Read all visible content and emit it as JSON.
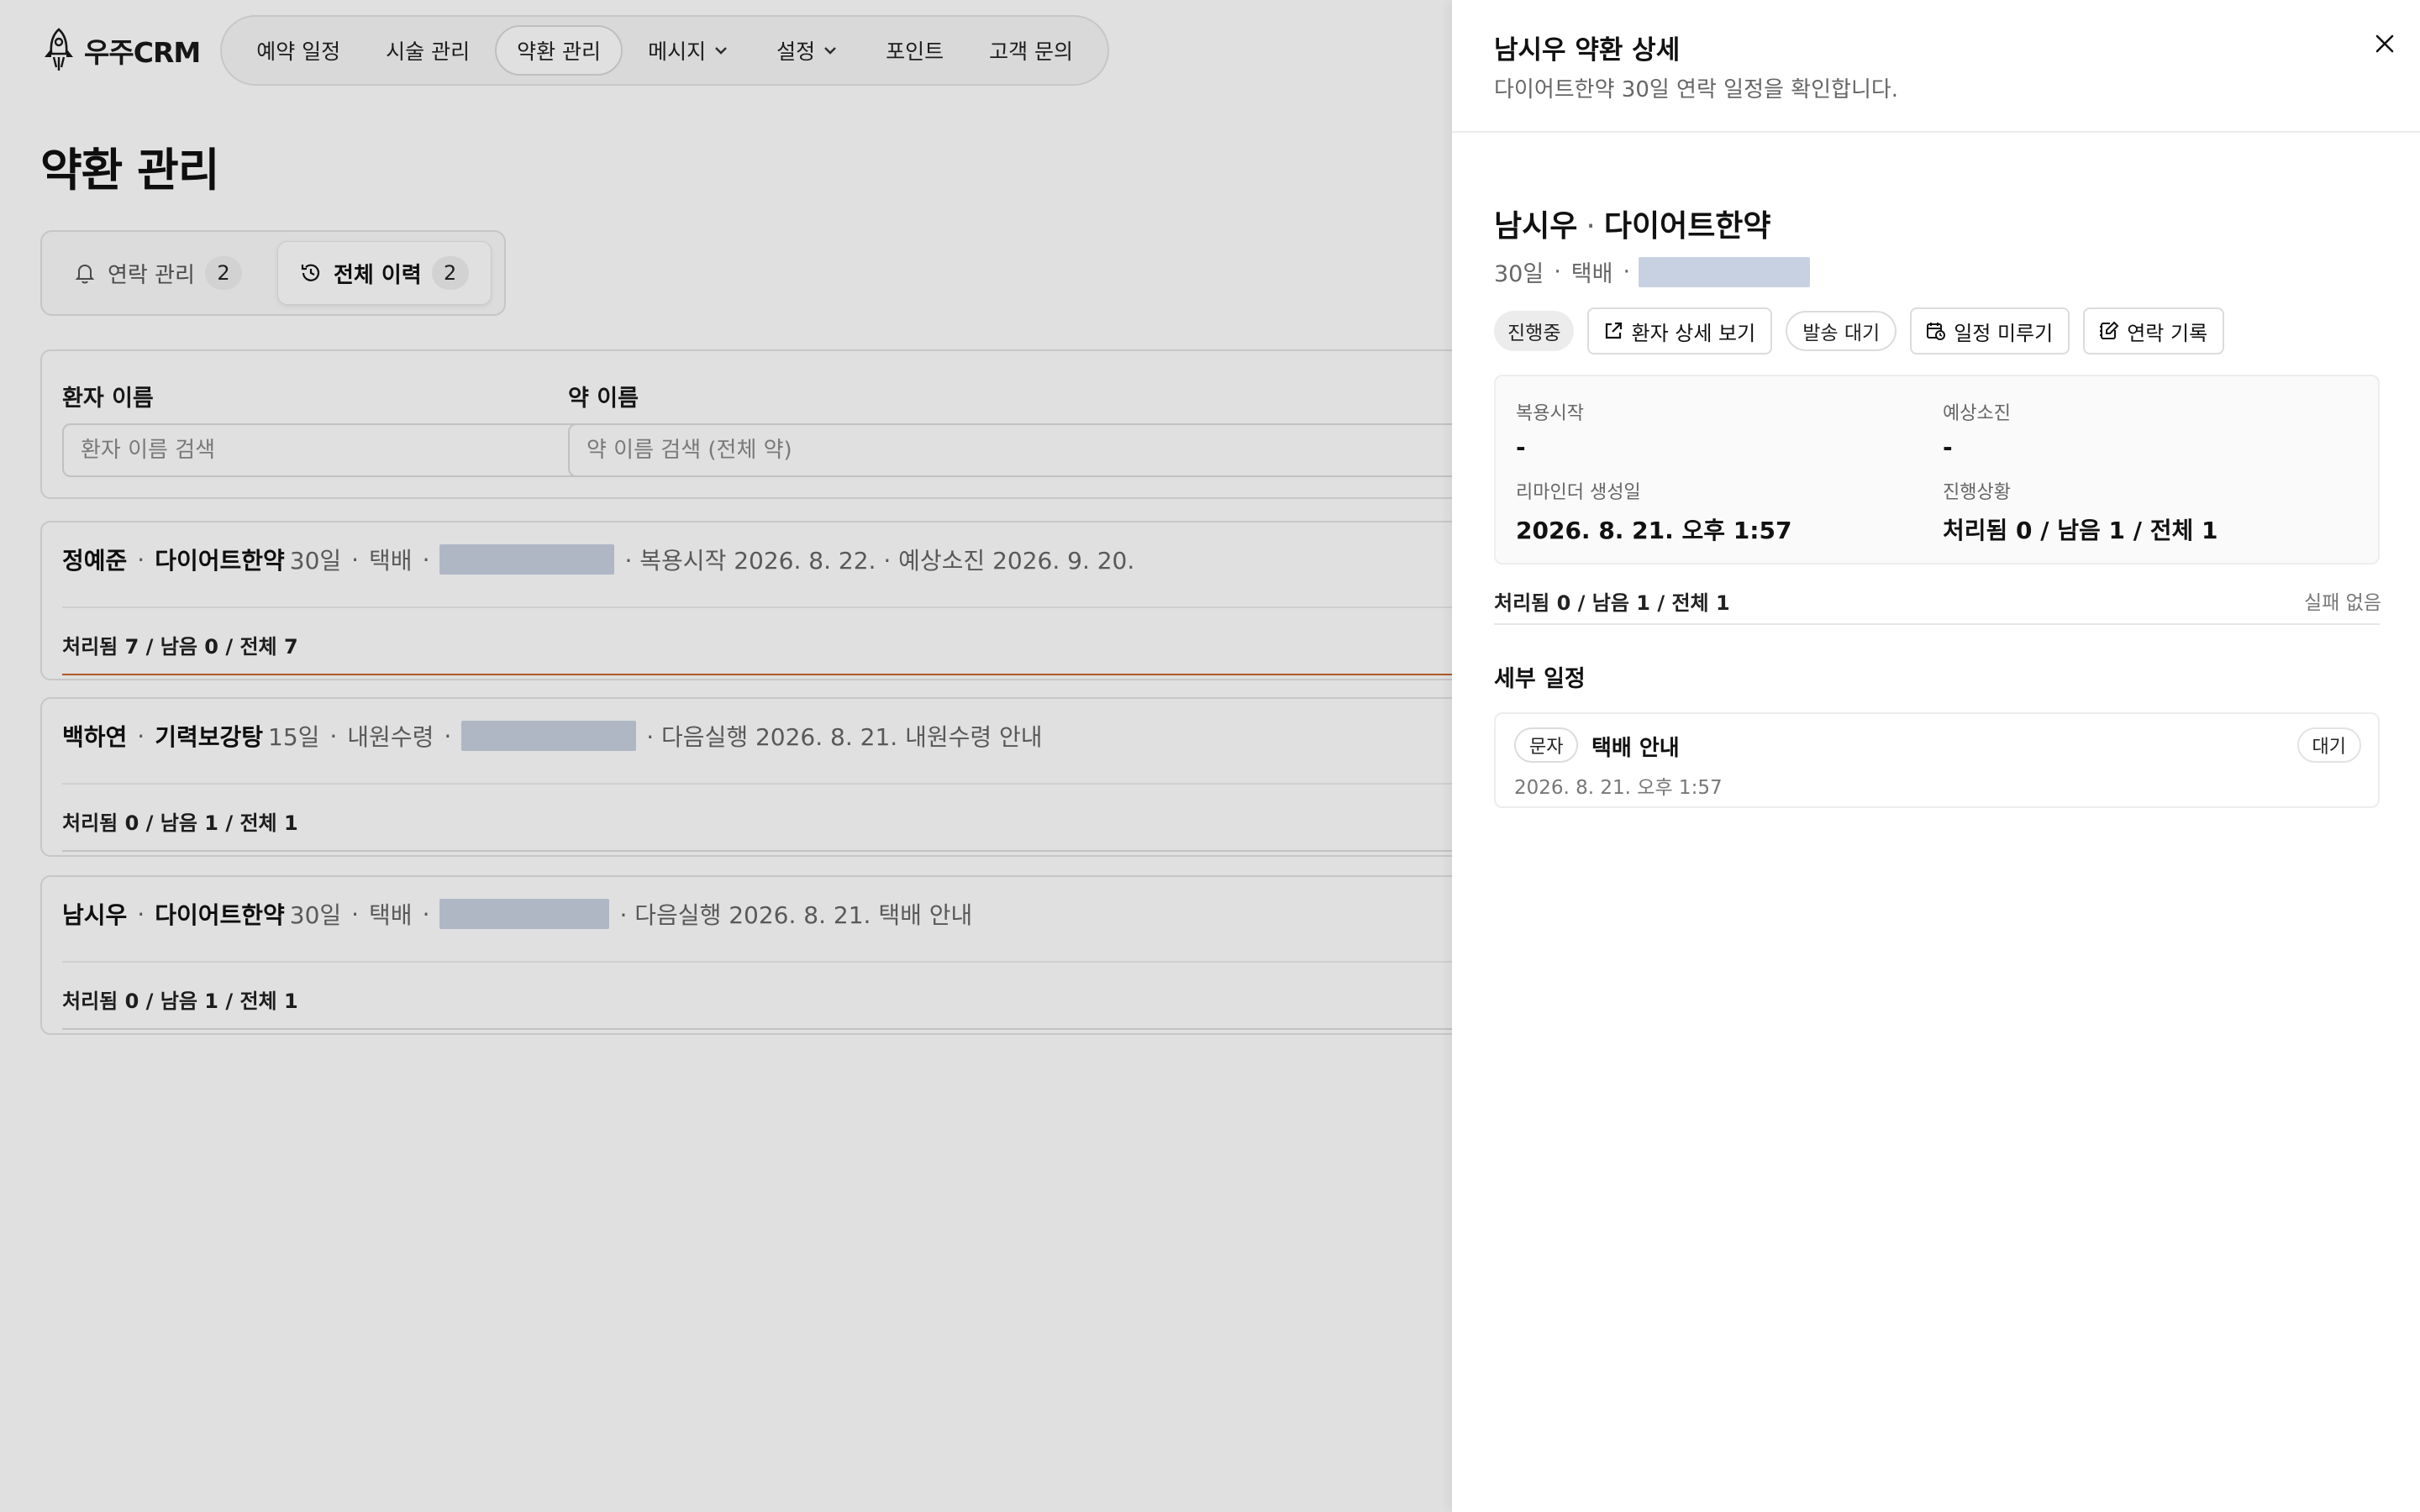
{
  "app": {
    "logo_text": "우주CRM",
    "nav": [
      {
        "label": "예약 일정"
      },
      {
        "label": "시술 관리"
      },
      {
        "label": "약환 관리"
      },
      {
        "label": "메시지"
      },
      {
        "label": "설정"
      },
      {
        "label": "포인트"
      },
      {
        "label": "고객 문의"
      }
    ],
    "active_nav": "약환 관리"
  },
  "page": {
    "title": "약환 관리",
    "tabs": [
      {
        "label": "연락 관리",
        "count": "2"
      },
      {
        "label": "전체 이력",
        "count": "2"
      }
    ],
    "active_tab": "전체 이력",
    "filters": {
      "patient_label": "환자 이름",
      "patient_placeholder": "환자 이름 검색",
      "drug_label": "약 이름",
      "drug_placeholder": "약 이름 검색 (전체 약)"
    },
    "rows": [
      {
        "patient": "정예준",
        "drug": "다이어트한약",
        "days": "30일",
        "delivery": "택배",
        "extra": "· 복용시작 2026. 8. 22. · 예상소진 2026. 9. 20.",
        "progress": "처리됨 7 / 남음 0 / 전체 7",
        "progress_fraction": 1.0
      },
      {
        "patient": "백하연",
        "drug": "기력보강탕",
        "days": "15일",
        "delivery": "내원수령",
        "extra": "· 다음실행 2026. 8. 21. 내원수령 안내",
        "progress": "처리됨 0 / 남음 1 / 전체 1",
        "progress_fraction": 0.0
      },
      {
        "patient": "남시우",
        "drug": "다이어트한약",
        "days": "30일",
        "delivery": "택배",
        "extra": "· 다음실행 2026. 8. 21. 택배 안내",
        "progress": "처리됨 0 / 남음 1 / 전체 1",
        "progress_fraction": 0.0
      }
    ]
  },
  "drawer": {
    "title": "남시우 약환 상세",
    "subtitle": "다이어트한약 30일 연락 일정을 확인합니다.",
    "patient": "남시우",
    "drug": "다이어트한약",
    "days": "30일",
    "delivery": "택배",
    "status_chip": "진행중",
    "actions": {
      "view_patient": "환자 상세 보기",
      "wait_chip": "발송 대기",
      "postpone": "일정 미루기",
      "contact_log": "연락 기록"
    },
    "info": {
      "start_label": "복용시작",
      "start_value": "-",
      "end_label": "예상소진",
      "end_value": "-",
      "created_label": "리마인더 생성일",
      "created_value": "2026. 8. 21. 오후 1:57",
      "status_label": "진행상황",
      "status_value": "처리됨 0 / 남음 1 / 전체 1"
    },
    "progress_text": "처리됨 0 / 남음 1 / 전체 1",
    "fail_text": "실패 없음",
    "section_title": "세부 일정",
    "schedule": [
      {
        "type": "문자",
        "title": "택배 안내",
        "date": "2026. 8. 21. 오후 1:57",
        "status": "대기"
      }
    ]
  },
  "colors": {
    "accent_progress": "#c9662a",
    "redaction": "#c8d1e1",
    "overlay": "rgba(0,0,0,0.12)"
  }
}
